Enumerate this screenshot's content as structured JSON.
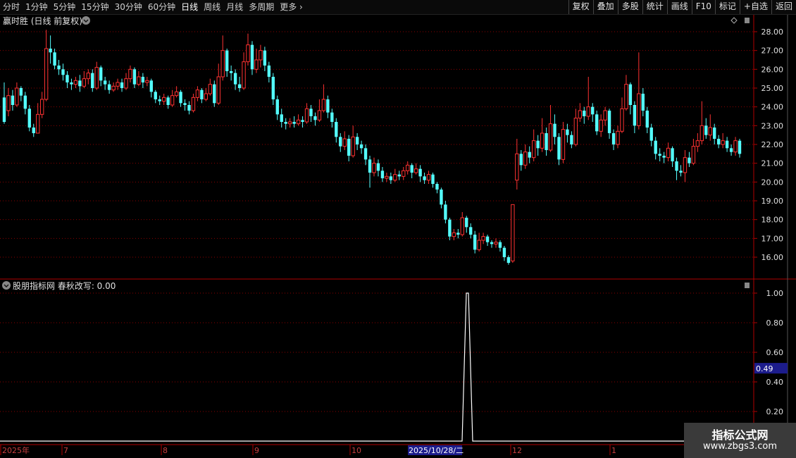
{
  "toolbar": {
    "periods": [
      "分时",
      "1分钟",
      "5分钟",
      "15分钟",
      "30分钟",
      "60分钟",
      "日线",
      "周线",
      "月线",
      "多周期",
      "更多"
    ],
    "active_period": "日线",
    "buttons": [
      "复权",
      "叠加",
      "多股",
      "统计",
      "画线",
      "F10",
      "标记",
      "+自选",
      "返回"
    ]
  },
  "main_panel": {
    "title": "赢时胜 (日线 前复权)",
    "y_ticks": [
      "28.00",
      "27.00",
      "26.00",
      "25.00",
      "24.00",
      "23.00",
      "22.00",
      "21.00",
      "20.00",
      "19.00",
      "18.00",
      "17.00",
      "16.00"
    ]
  },
  "indicator_panel": {
    "title": "股朋指标网 春秋改写: 0.00",
    "y_ticks": [
      "1.00",
      "0.80",
      "0.60",
      "0.40",
      "0.20"
    ],
    "marker_value": "0.49"
  },
  "x_axis": {
    "labels": [
      "2025年",
      "7",
      "8",
      "9",
      "10",
      "2025/10/28/二",
      "12",
      "1"
    ],
    "highlight": "2025/10/28/二"
  },
  "watermark": {
    "line1": "指标公式网",
    "line2": "www.zbgs3.com"
  },
  "colors": {
    "up": "#ff3232",
    "down": "#54ffff",
    "grid": "#8b0000",
    "axis": "#b00000",
    "indicator": "#ffffff",
    "highlight_bg": "#1c1c8c"
  },
  "chart_data": [
    {
      "type": "candlestick",
      "ylim": [
        15.5,
        28.4
      ],
      "candles": [
        [
          24.5,
          23.2,
          25.3,
          23.1
        ],
        [
          23.8,
          24.6,
          25.0,
          23.5
        ],
        [
          24.6,
          24.1,
          24.9,
          23.8
        ],
        [
          24.1,
          25.0,
          25.3,
          24.0
        ],
        [
          25.0,
          24.6,
          25.1,
          24.3
        ],
        [
          24.6,
          23.9,
          24.8,
          23.6
        ],
        [
          23.9,
          22.9,
          24.1,
          22.7
        ],
        [
          22.9,
          22.6,
          23.1,
          22.4
        ],
        [
          22.6,
          23.6,
          24.2,
          22.6
        ],
        [
          23.6,
          24.4,
          24.8,
          23.4
        ],
        [
          24.4,
          27.1,
          28.1,
          24.3
        ],
        [
          27.1,
          26.9,
          27.8,
          26.3
        ],
        [
          26.9,
          26.2,
          27.1,
          26.0
        ],
        [
          26.2,
          26.0,
          26.5,
          25.7
        ],
        [
          26.0,
          25.7,
          26.3,
          25.4
        ],
        [
          25.7,
          25.3,
          25.9,
          25.0
        ],
        [
          25.3,
          25.2,
          25.5,
          24.9
        ],
        [
          25.2,
          25.4,
          25.6,
          25.0
        ],
        [
          25.4,
          25.1,
          25.7,
          24.8
        ],
        [
          25.1,
          25.5,
          25.9,
          25.0
        ],
        [
          25.5,
          25.8,
          26.0,
          25.2
        ],
        [
          25.8,
          25.0,
          26.0,
          24.8
        ],
        [
          25.0,
          26.1,
          26.4,
          24.9
        ],
        [
          26.1,
          25.4,
          26.2,
          25.1
        ],
        [
          25.4,
          25.2,
          25.6,
          24.9
        ],
        [
          25.2,
          24.9,
          25.4,
          24.7
        ],
        [
          24.9,
          25.1,
          25.3,
          24.8
        ],
        [
          25.1,
          25.3,
          25.5,
          24.9
        ],
        [
          25.3,
          25.0,
          25.5,
          24.8
        ],
        [
          25.0,
          25.5,
          25.8,
          24.9
        ],
        [
          25.5,
          26.0,
          26.2,
          25.3
        ],
        [
          26.0,
          25.2,
          26.1,
          25.0
        ],
        [
          25.2,
          25.6,
          25.9,
          25.1
        ],
        [
          25.6,
          25.3,
          25.8,
          25.0
        ],
        [
          25.3,
          25.4,
          25.6,
          25.1
        ],
        [
          25.4,
          24.8,
          25.5,
          24.5
        ],
        [
          24.8,
          24.4,
          24.9,
          24.2
        ],
        [
          24.4,
          24.3,
          24.6,
          24.1
        ],
        [
          24.3,
          24.5,
          24.7,
          24.1
        ],
        [
          24.5,
          24.1,
          24.6,
          23.9
        ],
        [
          24.1,
          24.6,
          24.9,
          24.0
        ],
        [
          24.6,
          24.8,
          25.1,
          24.5
        ],
        [
          24.8,
          24.2,
          24.9,
          24.0
        ],
        [
          24.2,
          24.1,
          24.4,
          23.8
        ],
        [
          24.1,
          23.8,
          24.3,
          23.6
        ],
        [
          23.8,
          24.5,
          24.7,
          23.7
        ],
        [
          24.5,
          24.9,
          25.1,
          24.3
        ],
        [
          24.9,
          24.4,
          25.0,
          24.2
        ],
        [
          24.4,
          24.7,
          25.0,
          24.3
        ],
        [
          24.7,
          25.2,
          25.5,
          24.6
        ],
        [
          25.2,
          24.2,
          25.4,
          24.0
        ],
        [
          24.2,
          25.6,
          26.3,
          24.1
        ],
        [
          25.6,
          27.0,
          27.8,
          25.4
        ],
        [
          27.0,
          25.9,
          27.1,
          25.6
        ],
        [
          25.9,
          25.8,
          26.2,
          25.4
        ],
        [
          25.8,
          25.2,
          26.0,
          24.9
        ],
        [
          25.2,
          25.0,
          25.6,
          24.8
        ],
        [
          25.0,
          26.4,
          26.9,
          24.9
        ],
        [
          26.4,
          27.3,
          27.9,
          26.2
        ],
        [
          27.3,
          26.0,
          27.5,
          25.7
        ],
        [
          26.0,
          26.5,
          27.1,
          25.8
        ],
        [
          26.5,
          27.0,
          27.3,
          26.1
        ],
        [
          27.0,
          26.2,
          27.2,
          25.9
        ],
        [
          26.2,
          25.6,
          26.4,
          25.3
        ],
        [
          25.6,
          24.4,
          25.8,
          24.1
        ],
        [
          24.4,
          23.6,
          24.6,
          23.3
        ],
        [
          23.6,
          23.2,
          23.9,
          22.9
        ],
        [
          23.2,
          23.1,
          23.4,
          22.8
        ],
        [
          23.1,
          23.2,
          23.4,
          22.9
        ],
        [
          23.2,
          23.1,
          23.5,
          22.9
        ],
        [
          23.1,
          23.3,
          23.6,
          23.0
        ],
        [
          23.3,
          23.2,
          23.5,
          22.9
        ],
        [
          23.2,
          23.9,
          24.2,
          23.1
        ],
        [
          23.9,
          23.5,
          24.1,
          23.2
        ],
        [
          23.5,
          23.3,
          23.7,
          23.0
        ],
        [
          23.3,
          23.8,
          24.4,
          23.2
        ],
        [
          23.8,
          24.4,
          25.2,
          23.7
        ],
        [
          24.4,
          23.7,
          24.6,
          23.4
        ],
        [
          23.7,
          23.2,
          23.9,
          22.9
        ],
        [
          23.2,
          22.4,
          23.4,
          22.1
        ],
        [
          22.4,
          21.9,
          22.6,
          21.6
        ],
        [
          21.9,
          22.3,
          22.7,
          21.7
        ],
        [
          22.3,
          21.4,
          22.5,
          21.1
        ],
        [
          21.4,
          22.4,
          23.0,
          21.3
        ],
        [
          22.4,
          22.0,
          22.6,
          21.7
        ],
        [
          22.0,
          21.8,
          22.2,
          21.5
        ],
        [
          21.8,
          21.2,
          22.0,
          20.9
        ],
        [
          21.2,
          20.5,
          21.4,
          19.7
        ],
        [
          20.5,
          21.0,
          21.3,
          20.3
        ],
        [
          21.0,
          20.6,
          21.2,
          20.3
        ],
        [
          20.6,
          20.2,
          20.8,
          20.0
        ],
        [
          20.2,
          20.3,
          20.5,
          20.0
        ],
        [
          20.3,
          20.1,
          20.5,
          19.9
        ],
        [
          20.1,
          20.4,
          20.7,
          20.0
        ],
        [
          20.4,
          20.3,
          20.6,
          20.1
        ],
        [
          20.3,
          20.6,
          20.8,
          20.1
        ],
        [
          20.6,
          20.9,
          21.1,
          20.4
        ],
        [
          20.9,
          20.5,
          21.0,
          20.2
        ],
        [
          20.5,
          20.7,
          21.0,
          20.4
        ],
        [
          20.7,
          20.3,
          20.9,
          20.0
        ],
        [
          20.3,
          20.1,
          20.5,
          19.9
        ],
        [
          20.1,
          20.4,
          20.6,
          19.9
        ],
        [
          20.4,
          19.9,
          20.5,
          19.7
        ],
        [
          19.9,
          19.6,
          20.0,
          19.4
        ],
        [
          19.6,
          18.8,
          19.7,
          18.6
        ],
        [
          18.8,
          18.0,
          19.0,
          17.8
        ],
        [
          18.0,
          17.1,
          18.1,
          16.9
        ],
        [
          17.1,
          17.3,
          17.5,
          16.9
        ],
        [
          17.3,
          17.2,
          17.5,
          17.0
        ],
        [
          17.2,
          18.1,
          18.4,
          17.1
        ],
        [
          18.1,
          17.6,
          18.2,
          17.3
        ],
        [
          17.6,
          17.2,
          17.8,
          17.0
        ],
        [
          17.2,
          16.4,
          17.4,
          16.2
        ],
        [
          16.4,
          16.9,
          17.3,
          16.3
        ],
        [
          16.9,
          17.1,
          17.3,
          16.7
        ],
        [
          17.1,
          16.8,
          17.2,
          16.6
        ],
        [
          16.8,
          16.7,
          16.9,
          16.5
        ],
        [
          16.7,
          16.8,
          17.0,
          16.5
        ],
        [
          16.8,
          16.5,
          16.9,
          16.3
        ],
        [
          16.5,
          16.0,
          16.6,
          15.8
        ],
        [
          16.0,
          15.7,
          16.1,
          15.6
        ],
        [
          15.8,
          18.8,
          18.8,
          15.7
        ],
        [
          20.1,
          21.5,
          22.3,
          19.6
        ],
        [
          21.5,
          20.9,
          21.7,
          20.6
        ],
        [
          20.9,
          21.6,
          22.0,
          20.7
        ],
        [
          21.6,
          21.3,
          21.9,
          21.0
        ],
        [
          21.3,
          22.2,
          22.8,
          21.1
        ],
        [
          22.2,
          21.8,
          22.5,
          21.4
        ],
        [
          21.8,
          22.6,
          23.4,
          21.6
        ],
        [
          22.6,
          21.7,
          22.9,
          21.4
        ],
        [
          21.7,
          23.1,
          24.1,
          21.6
        ],
        [
          23.1,
          22.4,
          23.6,
          22.0
        ],
        [
          22.4,
          21.2,
          22.6,
          20.9
        ],
        [
          21.2,
          22.8,
          23.2,
          21.0
        ],
        [
          22.8,
          22.5,
          23.1,
          22.1
        ],
        [
          22.5,
          22.0,
          22.7,
          21.8
        ],
        [
          22.0,
          23.4,
          23.9,
          21.9
        ],
        [
          23.4,
          23.8,
          24.2,
          23.2
        ],
        [
          23.8,
          23.5,
          24.0,
          23.1
        ],
        [
          23.5,
          24.0,
          25.6,
          23.3
        ],
        [
          24.0,
          23.6,
          24.2,
          23.2
        ],
        [
          23.6,
          22.7,
          23.8,
          22.5
        ],
        [
          22.7,
          23.3,
          23.6,
          22.4
        ],
        [
          23.3,
          23.8,
          24.0,
          23.0
        ],
        [
          23.8,
          22.6,
          23.9,
          22.3
        ],
        [
          22.6,
          22.0,
          22.8,
          21.7
        ],
        [
          22.0,
          22.7,
          23.0,
          21.8
        ],
        [
          22.7,
          23.9,
          24.5,
          22.6
        ],
        [
          23.9,
          25.2,
          25.7,
          23.8
        ],
        [
          25.2,
          24.1,
          25.3,
          23.6
        ],
        [
          24.1,
          23.0,
          24.3,
          22.6
        ],
        [
          23.0,
          24.7,
          26.9,
          22.8
        ],
        [
          24.7,
          23.8,
          25.0,
          23.5
        ],
        [
          23.8,
          22.9,
          24.0,
          22.6
        ],
        [
          22.9,
          22.2,
          23.1,
          21.9
        ],
        [
          22.2,
          21.5,
          22.4,
          21.2
        ],
        [
          21.5,
          21.4,
          21.8,
          21.1
        ],
        [
          21.4,
          21.3,
          21.6,
          21.0
        ],
        [
          21.3,
          21.8,
          22.1,
          21.1
        ],
        [
          21.8,
          21.1,
          21.9,
          20.8
        ],
        [
          21.1,
          20.6,
          21.3,
          20.1
        ],
        [
          20.6,
          20.5,
          20.9,
          20.3
        ],
        [
          20.5,
          21.3,
          21.7,
          20.0
        ],
        [
          21.3,
          21.0,
          21.6,
          20.8
        ],
        [
          21.0,
          21.9,
          22.3,
          20.9
        ],
        [
          21.9,
          22.2,
          22.6,
          21.6
        ],
        [
          22.2,
          23.0,
          24.3,
          22.0
        ],
        [
          23.0,
          22.5,
          23.4,
          22.3
        ],
        [
          22.5,
          22.9,
          23.6,
          22.2
        ],
        [
          22.9,
          22.3,
          23.1,
          22.0
        ],
        [
          22.3,
          22.0,
          22.5,
          21.8
        ],
        [
          22.0,
          22.2,
          22.6,
          21.8
        ],
        [
          22.2,
          21.8,
          22.4,
          21.6
        ],
        [
          21.8,
          21.6,
          22.0,
          21.4
        ],
        [
          21.6,
          22.2,
          22.4,
          21.4
        ],
        [
          22.2,
          21.5,
          22.3,
          21.3
        ]
      ]
    },
    {
      "type": "line",
      "name": "春秋改写",
      "ylim": [
        0,
        1.05
      ],
      "spike_value": 1.0,
      "baseline": 0.0
    }
  ]
}
